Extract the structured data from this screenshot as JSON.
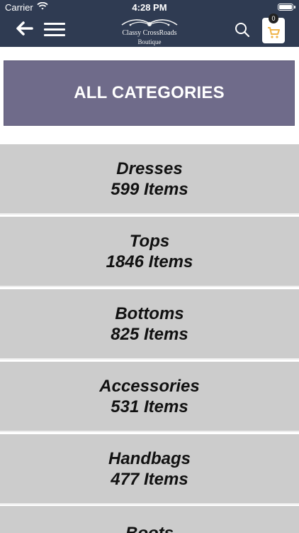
{
  "status_bar": {
    "carrier": "Carrier",
    "time": "4:28 PM"
  },
  "header": {
    "logo_title": "Classy CrossRoads",
    "logo_subtitle": "Boutique",
    "cart_count": "0"
  },
  "page": {
    "title": "ALL CATEGORIES"
  },
  "categories": [
    {
      "name": "Dresses",
      "count": "599 Items"
    },
    {
      "name": "Tops",
      "count": "1846 Items"
    },
    {
      "name": "Bottoms",
      "count": "825 Items"
    },
    {
      "name": "Accessories",
      "count": "531 Items"
    },
    {
      "name": "Handbags",
      "count": "477 Items"
    },
    {
      "name": "Boots",
      "count": ""
    }
  ],
  "colors": {
    "header_bg": "#2f3b52",
    "category_bg": "#cccccc",
    "title_bg": "#6f6b8a",
    "cart_icon": "#f0b44a"
  },
  "icons": {
    "back": "arrow-left-icon",
    "menu": "menu-icon",
    "search": "search-icon",
    "cart": "shopping-cart-icon",
    "wifi": "wifi-icon",
    "battery": "battery-icon"
  }
}
